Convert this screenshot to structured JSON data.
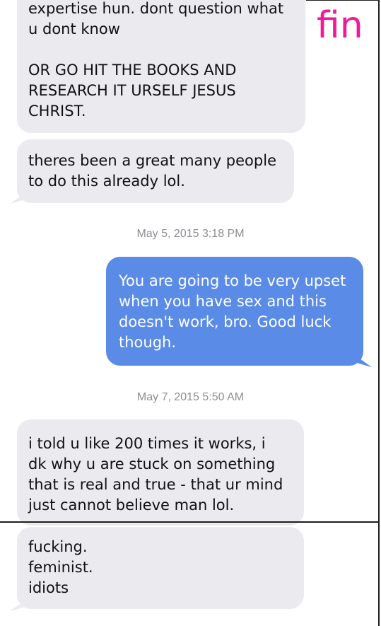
{
  "overlay_label": "fin",
  "messages": [
    {
      "direction": "received",
      "text": "expertise hun. dont question what\nu dont know\n\nOR GO HIT THE BOOKS AND\nRESEARCH IT URSELF JESUS\nCHRIST."
    },
    {
      "direction": "received",
      "text": "theres been a great many people\nto do this already lol."
    },
    {
      "direction": "sent",
      "text": "You are going to be very upset\nwhen you have sex and this\ndoesn't work, bro. Good luck\nthough."
    },
    {
      "direction": "received",
      "text": "i told u like 200 times it works, i\ndk why u are stuck on something\nthat is real and true - that ur mind\njust cannot believe man lol."
    },
    {
      "direction": "received",
      "text": "fucking.\nfeminist.\nidiots"
    }
  ],
  "timestamps": [
    "May 5, 2015 3:18 PM",
    "May 7, 2015 5:50 AM"
  ],
  "colors": {
    "received_bubble": "#eaeaef",
    "sent_bubble": "#5a8be6",
    "timestamp_text": "#8e8e93",
    "overlay_label": "#f0199a"
  }
}
